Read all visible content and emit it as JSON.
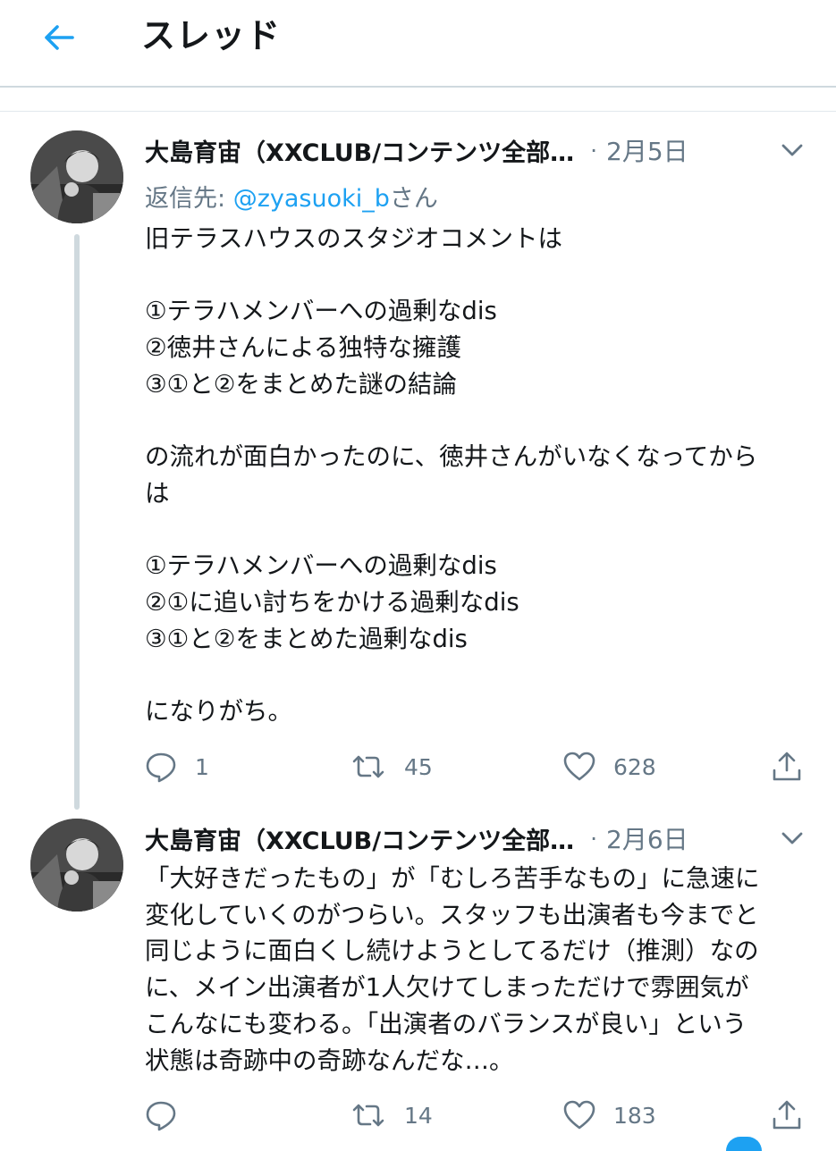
{
  "header": {
    "title": "スレッド",
    "back_icon": "arrow-left-icon",
    "accent": "#1da1f2"
  },
  "tweets": [
    {
      "author": "大島育宙（XXCLUB/コンテンツ全部…",
      "dot": "·",
      "date": "2月5日",
      "reply_prefix": "返信先:",
      "reply_handle": "@zyasuoki_b",
      "reply_suffix": "さん",
      "lines": [
        "旧テラスハウスのスタジオコメントは",
        "",
        "①テラハメンバーへの過剰なdis",
        "②徳井さんによる独特な擁護",
        "③①と②をまとめた謎の結論",
        "",
        "の流れが面白かったのに、徳井さんがいなくなってから",
        "は",
        "",
        "①テラハメンバーへの過剰なdis",
        "②①に追い討ちをかける過剰なdis",
        "③①と②をまとめた過剰なdis",
        "",
        "になりがち。"
      ],
      "replies": "1",
      "retweets": "45",
      "likes": "628"
    },
    {
      "author": "大島育宙（XXCLUB/コンテンツ全部…",
      "dot": "·",
      "date": "2月6日",
      "lines": [
        "「大好きだったもの」が「むしろ苦手なもの」に急速に",
        "変化していくのがつらい。スタッフも出演者も今までと",
        "同じように面白くし続けようとしてるだけ（推測）なの",
        "に、メイン出演者が1人欠けてしまっただけで雰囲気が",
        "こんなにも変わる。「出演者のバランスが良い」という",
        "状態は奇跡中の奇跡なんだな…。"
      ],
      "replies": "",
      "retweets": "14",
      "likes": "183"
    }
  ]
}
